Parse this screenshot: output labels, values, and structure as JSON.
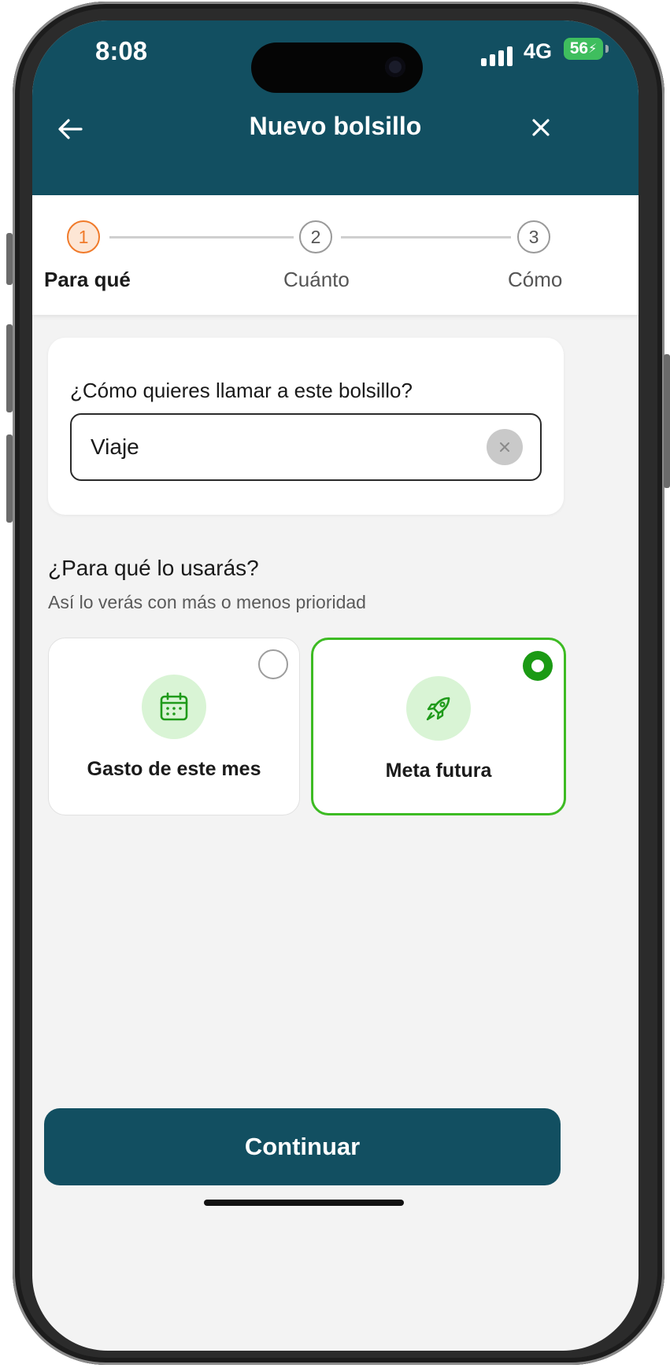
{
  "status_bar": {
    "time": "8:08",
    "network": "4G",
    "battery": "56"
  },
  "header": {
    "title": "Nuevo bolsillo",
    "back_icon": "arrow-left-icon",
    "close_icon": "close-icon"
  },
  "stepper": {
    "steps": [
      {
        "number": "1",
        "label": "Para qué",
        "active": true
      },
      {
        "number": "2",
        "label": "Cuánto",
        "active": false
      },
      {
        "number": "3",
        "label": "Cómo",
        "active": false
      }
    ]
  },
  "name_card": {
    "question": "¿Cómo quieres llamar a este bolsillo?",
    "input_value": "Viaje"
  },
  "purpose": {
    "title": "¿Para qué lo usarás?",
    "subtitle": "Así lo verás con más o menos prioridad",
    "options": [
      {
        "label": "Gasto de este mes",
        "icon": "calendar-icon",
        "selected": false
      },
      {
        "label": "Meta futura",
        "icon": "rocket-icon",
        "selected": true
      }
    ]
  },
  "footer": {
    "continue_label": "Continuar"
  },
  "colors": {
    "header": "#124f61",
    "step_active": "#f07a2a",
    "selected": "#3dbb23",
    "icon_bg": "#d9f4d5"
  }
}
